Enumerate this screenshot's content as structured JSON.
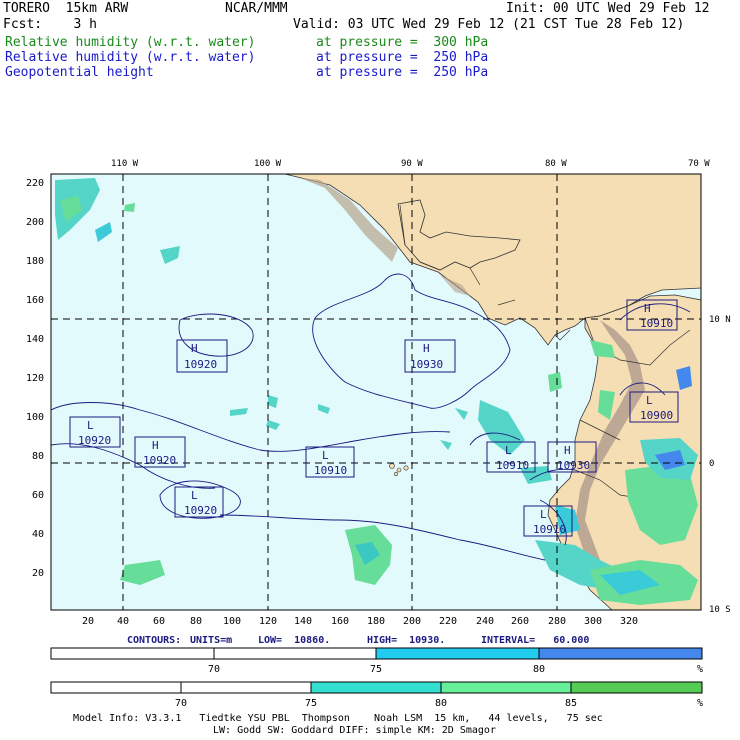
{
  "header": {
    "model": "TORERO  15km ARW",
    "center": "NCAR/MMM",
    "init": "Init: 00 UTC Wed 29 Feb 12",
    "fcst": "Fcst:    3 h",
    "valid": "Valid: 03 UTC Wed 29 Feb 12 (21 CST Tue 28 Feb 12)",
    "fields": [
      {
        "name": "Relative humidity (w.r.t. water)",
        "level": "at pressure =  300 hPa",
        "color": "#1a8a1a"
      },
      {
        "name": "Relative humidity (w.r.t. water)",
        "level": "at pressure =  250 hPa",
        "color": "#1a1acc"
      },
      {
        "name": "Geopotential height",
        "level": "at pressure =  250 hPa",
        "color": "#1a1acc"
      }
    ]
  },
  "map": {
    "top_lon_labels": [
      "110 W",
      "100 W",
      "90 W",
      "80 W",
      "70 W"
    ],
    "right_lat_labels": [
      "10 N",
      "0",
      "10 S"
    ],
    "left_ticks": [
      "220",
      "200",
      "180",
      "160",
      "140",
      "120",
      "100",
      "80",
      "60",
      "40",
      "20"
    ],
    "bottom_ticks": [
      "20",
      "40",
      "60",
      "80",
      "100",
      "120",
      "140",
      "160",
      "180",
      "200",
      "220",
      "240",
      "260",
      "280",
      "300",
      "320"
    ],
    "centers": [
      {
        "type": "H",
        "value": "10920"
      },
      {
        "type": "H",
        "value": "10930"
      },
      {
        "type": "H",
        "value": "10910"
      },
      {
        "type": "L",
        "value": "10920"
      },
      {
        "type": "H",
        "value": "10920"
      },
      {
        "type": "L",
        "value": "10910"
      },
      {
        "type": "L",
        "value": "10920"
      },
      {
        "type": "L",
        "value": "10910"
      },
      {
        "type": "H",
        "value": "10930"
      },
      {
        "type": "L",
        "value": "10900"
      },
      {
        "type": "L",
        "value": "10910"
      }
    ],
    "colors": {
      "ocean": "#e3fafd",
      "land": "#f5deb3",
      "contour": "#1a1a80"
    }
  },
  "contours_info": {
    "label": "CONTOURS:",
    "units": "UNITS=m",
    "low": "LOW=  10860.",
    "high": "HIGH=  10930.",
    "interval": "INTERVAL=   60.000"
  },
  "colorbar1": {
    "labels": [
      "70",
      "75",
      "80"
    ],
    "unit": "%",
    "colors": [
      "#ffffff",
      "#ffffff",
      "#22ccee",
      "#4488ee"
    ]
  },
  "colorbar2": {
    "labels": [
      "70",
      "75",
      "80",
      "85"
    ],
    "unit": "%",
    "colors": [
      "#ffffff",
      "#ffffff",
      "#33e0d0",
      "#66ee99",
      "#55cc55"
    ]
  },
  "footer": {
    "line1": "Model Info: V3.3.1   Tiedtke YSU PBL  Thompson    Noah LSM  15 km,   44 levels,   75 sec",
    "line2": "LW: Godd SW: Goddard DIFF: simple KM: 2D Smagor"
  }
}
